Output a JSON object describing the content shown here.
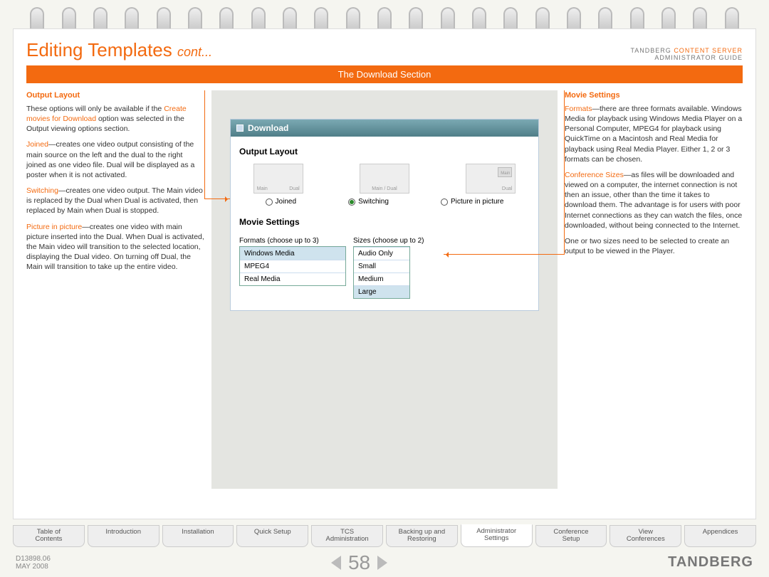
{
  "header": {
    "title_main": "Editing Templates ",
    "title_cont": "cont...",
    "brand_pre": "TANDBERG ",
    "brand_cs": "CONTENT SERVER",
    "guide": "ADMINISTRATOR GUIDE"
  },
  "section_bar": "The Download Section",
  "left": {
    "h": "Output Layout",
    "p1a": "These options will only be available if the ",
    "p1b": "Create movies for Download",
    "p1c": " option was selected in the Output viewing options section.",
    "joined_t": "Joined",
    "joined_b": "—creates one video output consisting of the main source on the left and the dual to the right joined as one video file. Dual will be displayed as a poster when it is not activated.",
    "switch_t": "Switching",
    "switch_b": "—creates one video output. The Main video is replaced by the Dual when Dual is activated, then replaced by Main when Dual is stopped.",
    "pip_t": "Picture in picture",
    "pip_b": "—creates one video with main picture inserted into the Dual. When Dual is activated, the Main video will transition to the selected location, displaying the Dual video. On turning off Dual, the Main will transition to take up the entire video."
  },
  "mid": {
    "panel_title": "Download",
    "h_layout": "Output Layout",
    "thumb1_l": "Main",
    "thumb1_r": "Dual",
    "thumb2": "Main / Dual",
    "thumb3_pip": "Main",
    "thumb3_r": "Dual",
    "r_joined": "Joined",
    "r_switch": "Switching",
    "r_pip": "Picture in picture",
    "h_ms": "Movie Settings",
    "formats_h": "Formats (choose up to 3)",
    "sizes_h": "Sizes (choose up to 2)",
    "fmt1": "Windows Media",
    "fmt2": "MPEG4",
    "fmt3": "Real Media",
    "sz1": "Audio Only",
    "sz2": "Small",
    "sz3": "Medium",
    "sz4": "Large"
  },
  "right": {
    "h": "Movie Settings",
    "fmt_t": "Formats",
    "fmt_b": "—there are three formats available. Windows Media for playback using Windows Media Player on a Personal Computer, MPEG4 for playback using QuickTime on a Macintosh and Real Media for playback using Real Media Player. Either 1, 2 or 3 formats can be chosen.",
    "cs_t": "Conference Sizes",
    "cs_b": "—as files will be downloaded and viewed on a computer, the internet connection is not then an issue, other than the time it takes to download them. The advantage is for users with poor Internet connections as they can watch the files, once downloaded, without being connected to the Internet.",
    "note": "One or two sizes need to be selected to create an output to be viewed in the Player."
  },
  "tabs": [
    "Table of\nContents",
    "Introduction",
    "Installation",
    "Quick Setup",
    "TCS\nAdministration",
    "Backing up and\nRestoring",
    "Administrator\nSettings",
    "Conference\nSetup",
    "View\nConferences",
    "Appendices"
  ],
  "active_tab_index": 6,
  "footer": {
    "doc": "D13898.06",
    "date": "MAY 2008",
    "page": "58",
    "brand": "TANDBERG"
  }
}
